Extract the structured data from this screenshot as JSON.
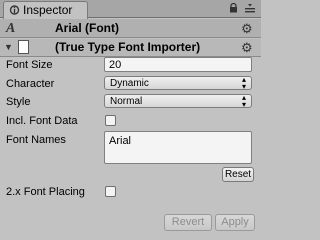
{
  "window": {
    "tab_label": "Inspector"
  },
  "asset": {
    "title": "Arial (Font)",
    "icon_glyph": "A"
  },
  "component": {
    "title": "(True Type Font Importer)"
  },
  "properties": {
    "font_size": {
      "label": "Font Size",
      "value": "20"
    },
    "character": {
      "label": "Character",
      "value": "Dynamic"
    },
    "style": {
      "label": "Style",
      "value": "Normal"
    },
    "incl_font_data": {
      "label": "Incl. Font Data",
      "checked": false
    },
    "font_names": {
      "label": "Font Names",
      "value": "Arial"
    },
    "font_placing": {
      "label": "2.x Font Placing",
      "checked": false
    }
  },
  "buttons": {
    "reset": "Reset",
    "revert": "Revert",
    "apply": "Apply"
  },
  "icons": {
    "tab": "inspector-icon",
    "lock": "lock-icon",
    "menu": "menu-icon",
    "asset": "font-asset-icon",
    "settings": "gear-icon",
    "foldout": "foldout-arrow-icon",
    "document": "document-icon"
  }
}
